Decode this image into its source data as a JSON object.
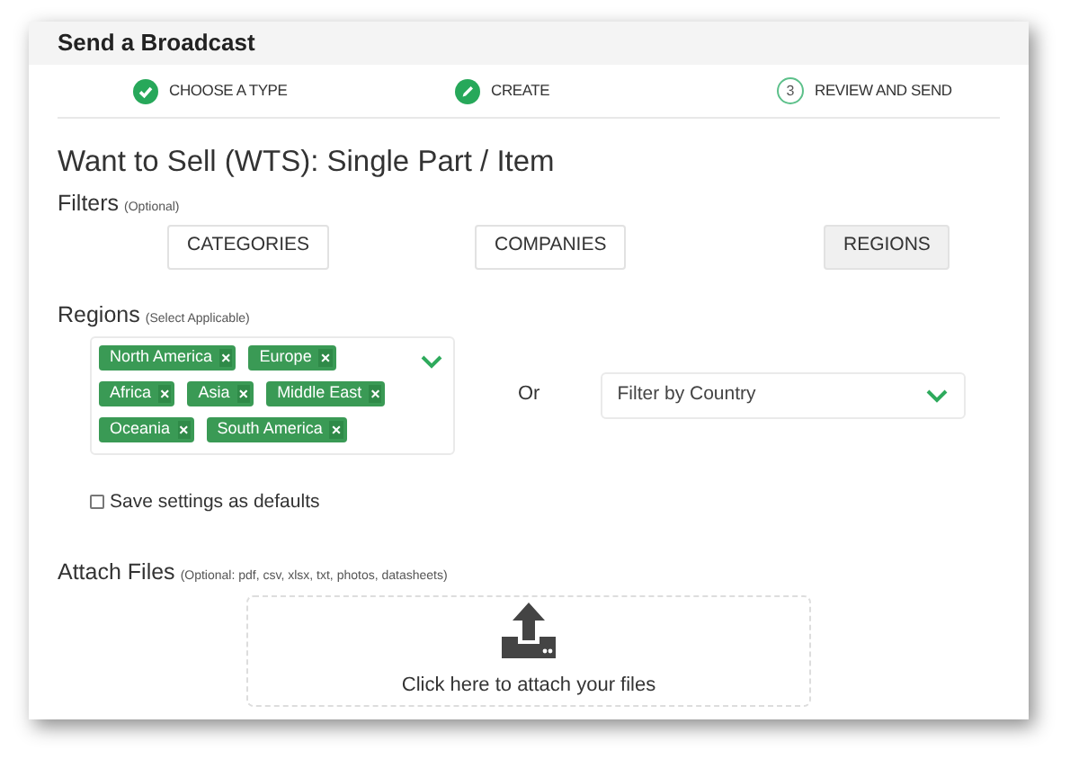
{
  "window": {
    "title": "Send a Broadcast"
  },
  "steps": [
    {
      "kind": "done",
      "label": "CHOOSE A TYPE"
    },
    {
      "kind": "edit",
      "label": "CREATE"
    },
    {
      "kind": "pending",
      "number": "3",
      "label": "REVIEW AND SEND"
    }
  ],
  "heading": "Want to Sell (WTS): Single Part / Item",
  "filters": {
    "label": "Filters",
    "note": "(Optional)",
    "buttons": [
      {
        "label": "CATEGORIES",
        "selected": false
      },
      {
        "label": "COMPANIES",
        "selected": false
      },
      {
        "label": "REGIONS",
        "selected": true
      }
    ]
  },
  "regions": {
    "label": "Regions",
    "note": "(Select Applicable)",
    "tags": [
      "North America",
      "Europe",
      "Africa",
      "Asia",
      "Middle East",
      "Oceania",
      "South America"
    ],
    "remove_glyph": "×",
    "or": "Or",
    "country_select": {
      "placeholder": "Filter by Country"
    }
  },
  "save_defaults": {
    "label": "Save settings as defaults",
    "checked": false
  },
  "attach": {
    "label": "Attach Files",
    "note": "(Optional: pdf, csv, xlsx, txt, photos, datasheets)",
    "dropzone_text": "Click here to attach your files"
  }
}
